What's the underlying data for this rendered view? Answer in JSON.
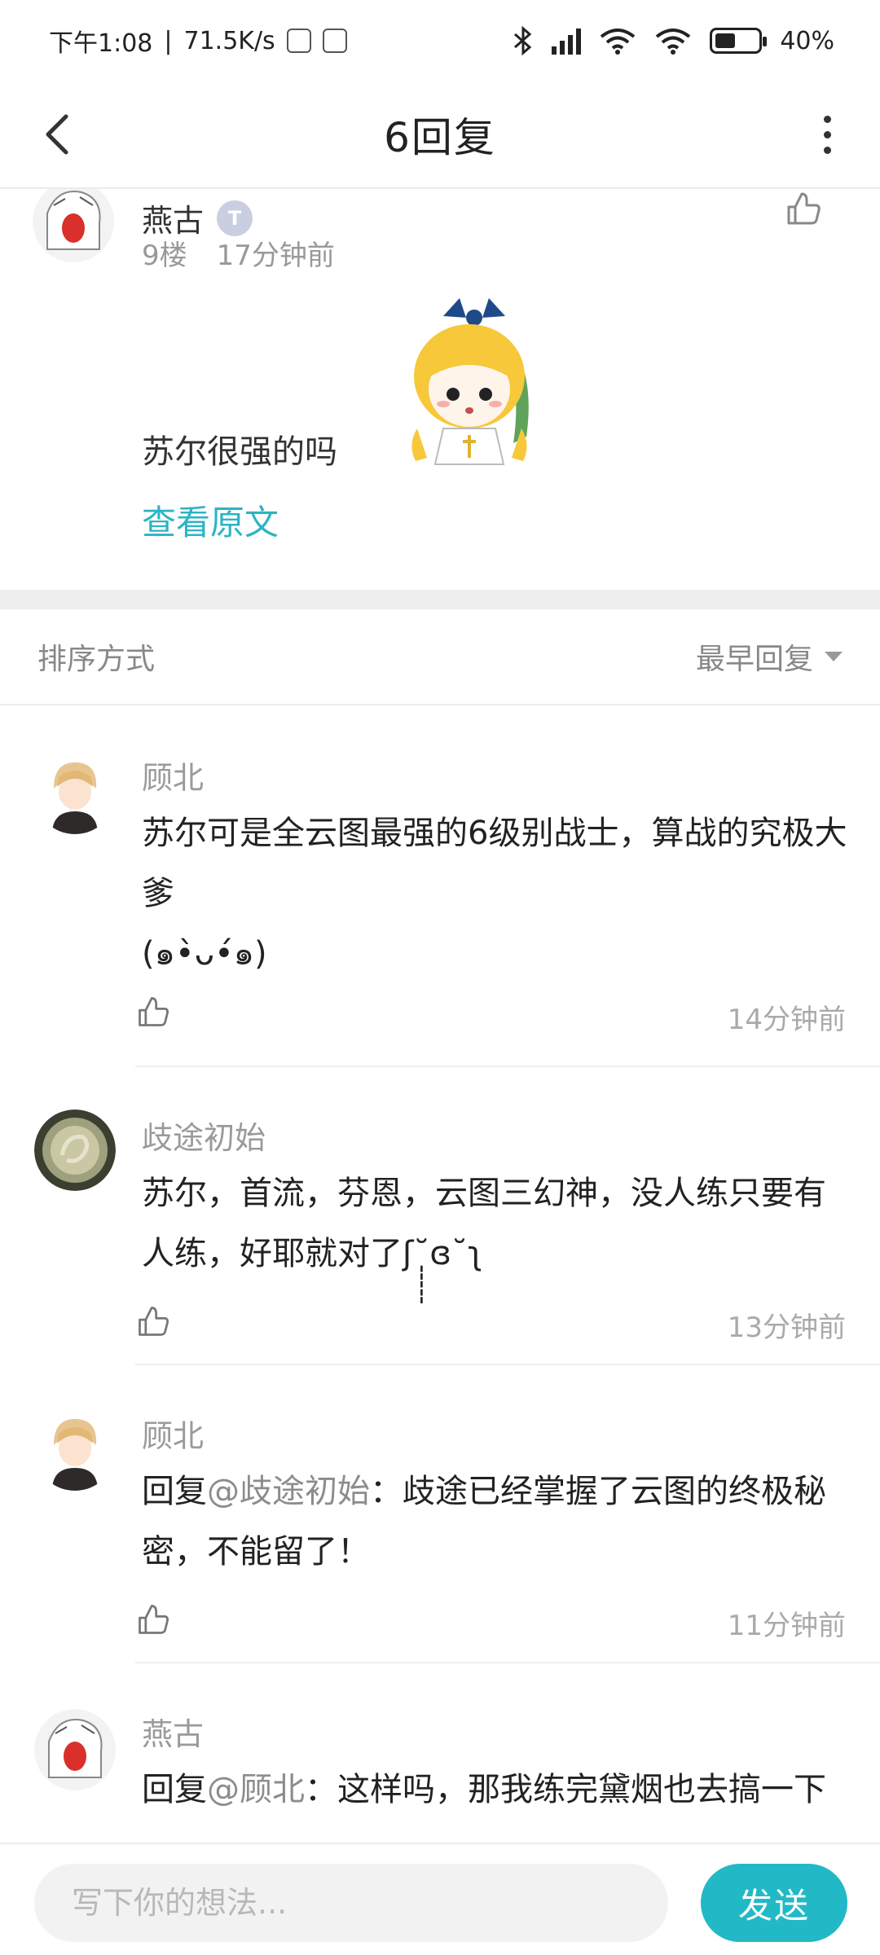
{
  "status_bar": {
    "time": "下午1:08",
    "net_speed": "71.5K/s",
    "battery": "40%",
    "battery_level": 0.4
  },
  "header": {
    "title": "6回复"
  },
  "post": {
    "author": "燕古",
    "badge": "T",
    "floor": "9楼",
    "time": "17分钟前",
    "text": "苏尔很强的吗",
    "view_original": "查看原文"
  },
  "sort": {
    "label": "排序方式",
    "selected": "最早回复"
  },
  "replies": [
    {
      "name": "顾北",
      "text": "苏尔可是全云图最强的6级别战士，算战的究极大爹\n(๑•̀ᴗ•́๑)",
      "mention": "",
      "time": "14分钟前"
    },
    {
      "name": "歧途初始",
      "text": "苏尔，首流，芬恩，云图三幻神，没人练只要有人练，好耶就对了ʃ˘̩̩̩̩̩ɞ˘ʅ",
      "mention": "",
      "time": "13分钟前"
    },
    {
      "name": "顾北",
      "prefix": "回复",
      "mention": "@歧途初始",
      "text": "：歧途已经掌握了云图的终极秘密，不能留了！",
      "time": "11分钟前"
    },
    {
      "name": "燕古",
      "prefix": "回复",
      "mention": "@顾北",
      "text": "：这样吗，那我练完黛烟也去搞一下",
      "time": ""
    }
  ],
  "composer": {
    "placeholder": "写下你的想法...",
    "send_label": "发送"
  },
  "colors": {
    "accent": "#22b9c6",
    "link": "#2cb4c3"
  }
}
